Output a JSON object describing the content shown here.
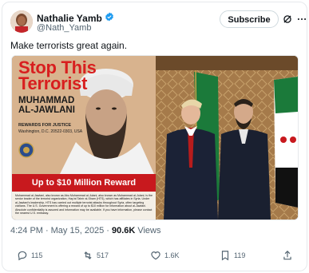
{
  "author": {
    "name": "Nathalie Yamb",
    "handle": "@Nath_Yamb",
    "verified": true
  },
  "actions_top": {
    "subscribe_label": "Subscribe"
  },
  "tweet": {
    "text": "Make terrorists great again."
  },
  "poster": {
    "title_line1": "Stop This",
    "title_line2": "Terrorist",
    "name_line1": "MUHAMMAD",
    "name_line2": "AL-JAWLANI",
    "rewards_heading": "REWARDS FOR JUSTICE",
    "rewards_contact": "Washington, D.C. 20522-0303, USA",
    "reward_amount": "Up to $10 Million Reward",
    "fine_print": "Muhammad al-Jawlani, also known as Abu Muhammad al-Julani, also known as Muhammad al-Jolani, is the senior leader of the terrorist organization, Hay'at Tahrir al-Sham (HTS), which has affiliates in Syria. Under al-Jawlani's leadership, HTS has carried out multiple terrorist attacks throughout Syria, often targeting civilians. The U.S. Government is offering a reward of up to $10 million for information about al-Jawlani. Absolute confidentiality is assured and information may be available. If you have information, please contact the nearest U.S. embassy."
  },
  "meta": {
    "time": "4:24 PM",
    "date": "May 15, 2025",
    "views_count": "90.6K",
    "views_label": "Views"
  },
  "stats": {
    "replies": "115",
    "reposts": "517",
    "likes": "1.6K",
    "bookmarks": "119"
  }
}
